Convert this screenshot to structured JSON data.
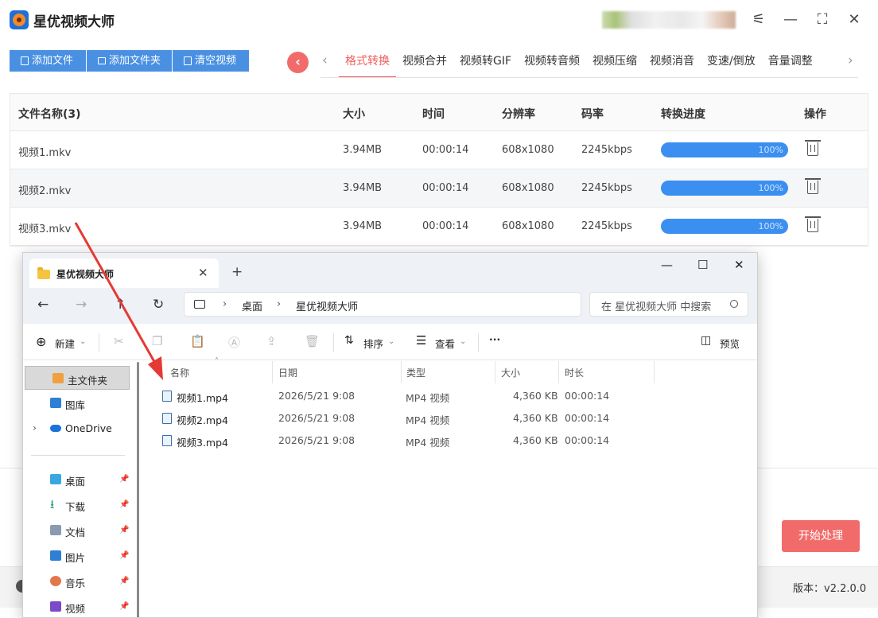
{
  "app": {
    "title": "星优视频大师",
    "toolbar": {
      "add_file": "添加文件",
      "add_folder": "添加文件夹",
      "clear": "清空视频"
    },
    "tabs": [
      "格式转换",
      "视频合并",
      "视频转GIF",
      "视频转音频",
      "视频压缩",
      "视频消音",
      "变速/倒放",
      "音量调整"
    ],
    "active_tab": "格式转换",
    "table": {
      "headers": {
        "name": "文件名称(3)",
        "size": "大小",
        "time": "时间",
        "resolution": "分辨率",
        "bitrate": "码率",
        "progress": "转换进度",
        "action": "操作"
      },
      "rows": [
        {
          "name": "视频1.mkv",
          "size": "3.94MB",
          "time": "00:00:14",
          "resolution": "608x1080",
          "bitrate": "2245kbps",
          "progress": "100%"
        },
        {
          "name": "视频2.mkv",
          "size": "3.94MB",
          "time": "00:00:14",
          "resolution": "608x1080",
          "bitrate": "2245kbps",
          "progress": "100%"
        },
        {
          "name": "视频3.mkv",
          "size": "3.94MB",
          "time": "00:00:14",
          "resolution": "608x1080",
          "bitrate": "2245kbps",
          "progress": "100%"
        }
      ]
    },
    "start_button": "开始处理",
    "version": "版本：v2.2.0.0",
    "accent": "#f26b6b",
    "primary": "#4a90e2"
  },
  "explorer": {
    "tab_title": "星优视频大师",
    "breadcrumb": [
      "桌面",
      "星优视频大师"
    ],
    "search_placeholder": "在 星优视频大师 中搜索",
    "commands": {
      "new": "新建",
      "sort": "排序",
      "view": "查看",
      "more": "···",
      "preview": "预览"
    },
    "sidebar": {
      "top": [
        "主文件夹",
        "图库",
        "OneDrive"
      ],
      "quick": [
        "桌面",
        "下载",
        "文档",
        "图片",
        "音乐",
        "视频"
      ]
    },
    "columns": {
      "name": "名称",
      "date": "日期",
      "type": "类型",
      "size": "大小",
      "duration": "时长"
    },
    "files": [
      {
        "name": "视频1.mp4",
        "date": "2026/5/21 9:08",
        "type": "MP4 视频",
        "size": "4,360 KB",
        "duration": "00:00:14"
      },
      {
        "name": "视频2.mp4",
        "date": "2026/5/21 9:08",
        "type": "MP4 视频",
        "size": "4,360 KB",
        "duration": "00:00:14"
      },
      {
        "name": "视频3.mp4",
        "date": "2026/5/21 9:08",
        "type": "MP4 视频",
        "size": "4,360 KB",
        "duration": "00:00:14"
      }
    ]
  }
}
